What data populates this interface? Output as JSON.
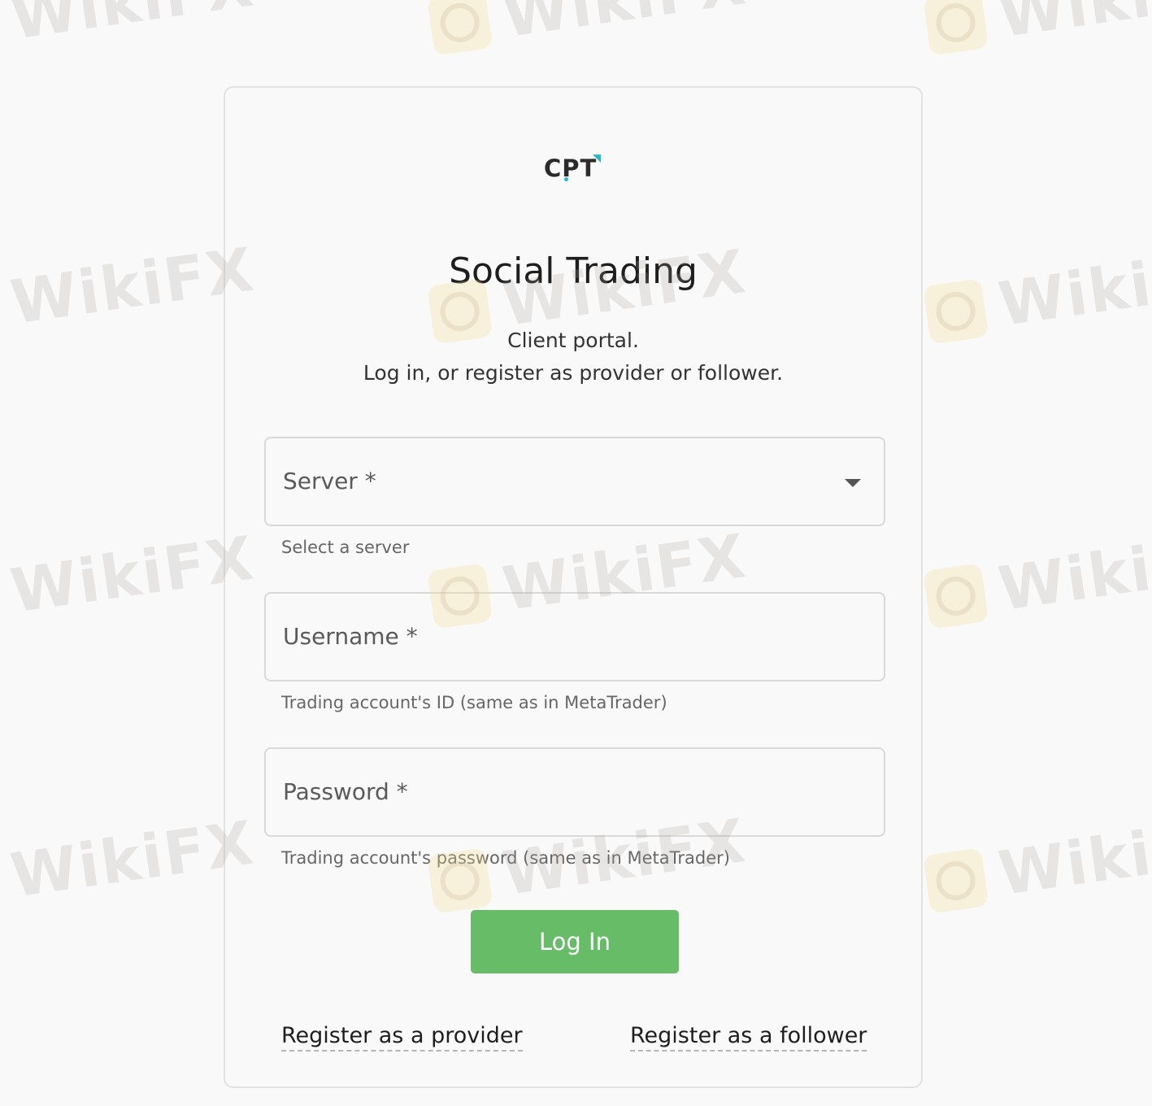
{
  "logo": {
    "text": "CPT"
  },
  "header": {
    "title": "Social Trading",
    "subtitle_line1": "Client portal.",
    "subtitle_line2": "Log in, or register as provider or follower."
  },
  "form": {
    "server": {
      "label": "Server *",
      "hint": "Select a server"
    },
    "username": {
      "label": "Username *",
      "hint": "Trading account's ID (same as in MetaTrader)"
    },
    "password": {
      "label": "Password *",
      "hint": "Trading account's password (same as in MetaTrader)"
    },
    "login_label": "Log In"
  },
  "links": {
    "register_provider": "Register as a provider",
    "register_follower": "Register as a follower"
  },
  "watermark": {
    "text": "WikiFX"
  },
  "colors": {
    "accent_button": "#67bd67",
    "logo_accent": "#25b8c8",
    "background": "#f9f9f9"
  }
}
